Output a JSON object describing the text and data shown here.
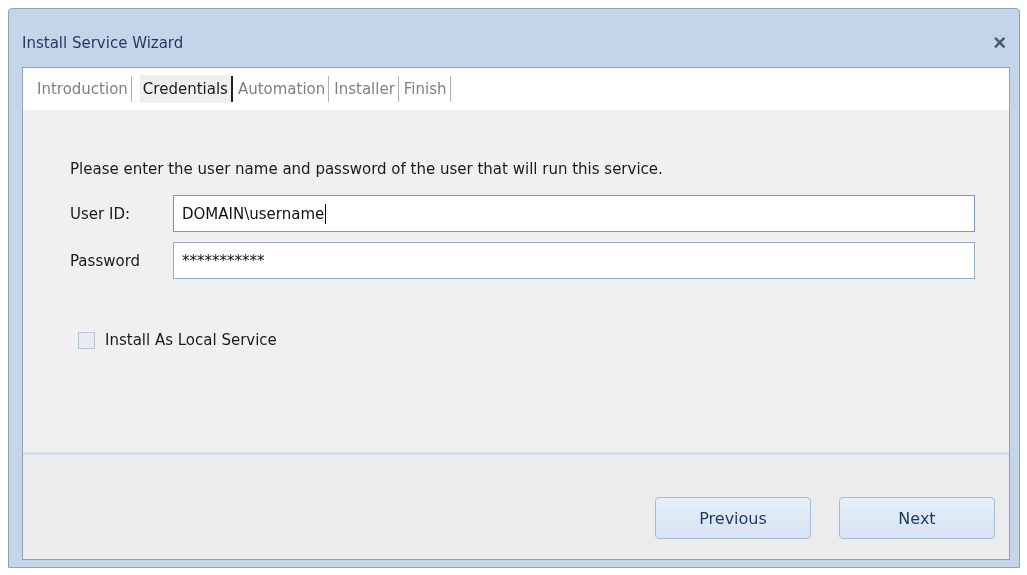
{
  "window": {
    "title": "Install Service Wizard",
    "close": "×"
  },
  "tabs": [
    {
      "label": "Introduction",
      "selected": false
    },
    {
      "label": "Credentials",
      "selected": true
    },
    {
      "label": "Automation",
      "selected": false
    },
    {
      "label": "Installer",
      "selected": false
    },
    {
      "label": "Finish",
      "selected": false
    }
  ],
  "instructions": "Please enter the user name and password of the user that will run this service.",
  "fields": [
    {
      "label": "User ID:",
      "value": "DOMAIN\\username",
      "focused": true
    },
    {
      "label": "Password",
      "value": "***********",
      "focused": false
    }
  ],
  "checkbox": {
    "label": "Install As Local Service",
    "checked": false
  },
  "buttons": [
    "Previous",
    "Next"
  ]
}
